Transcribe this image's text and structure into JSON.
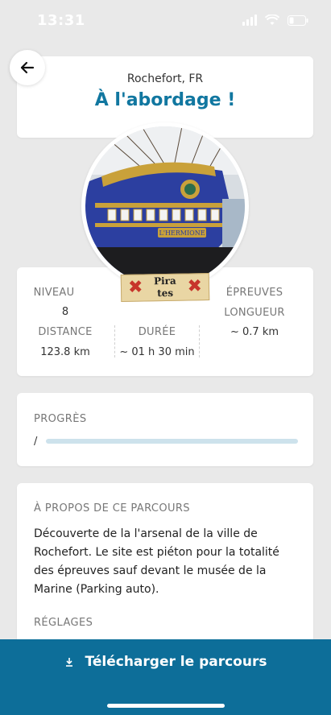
{
  "status": {
    "time": "13:31"
  },
  "header": {
    "location": "Rochefort, FR",
    "title": "À l'abordage !"
  },
  "badge": {
    "label_line1": "Pira",
    "label_line2": "tes",
    "mark": "✖"
  },
  "stats": {
    "niveau_label": "NIVEAU",
    "niveau_value": "8",
    "epreuves_label": "ÉPREUVES",
    "longueur_label": "LONGUEUR",
    "longueur_value": "~ 0.7 km",
    "distance_label": "DISTANCE",
    "distance_value": "123.8 km",
    "duree_label": "DURÉE",
    "duree_value": "~ 01 h 30 min"
  },
  "progress": {
    "title": "PROGRÈS",
    "slash": "/",
    "fraction": 0
  },
  "about": {
    "title": "À PROPOS DE CE PARCOURS",
    "text": "Découverte de la l'arsenal de la ville de Rochefort. Le site est piéton pour la totalité des épreuves sauf devant le musée de la Marine (Parking auto).",
    "settings_title": "RÉGLAGES"
  },
  "download": {
    "label": "Télécharger le parcours"
  },
  "colors": {
    "accent": "#1177a0",
    "bar": "#0d6e99",
    "track": "#cde2ec"
  }
}
